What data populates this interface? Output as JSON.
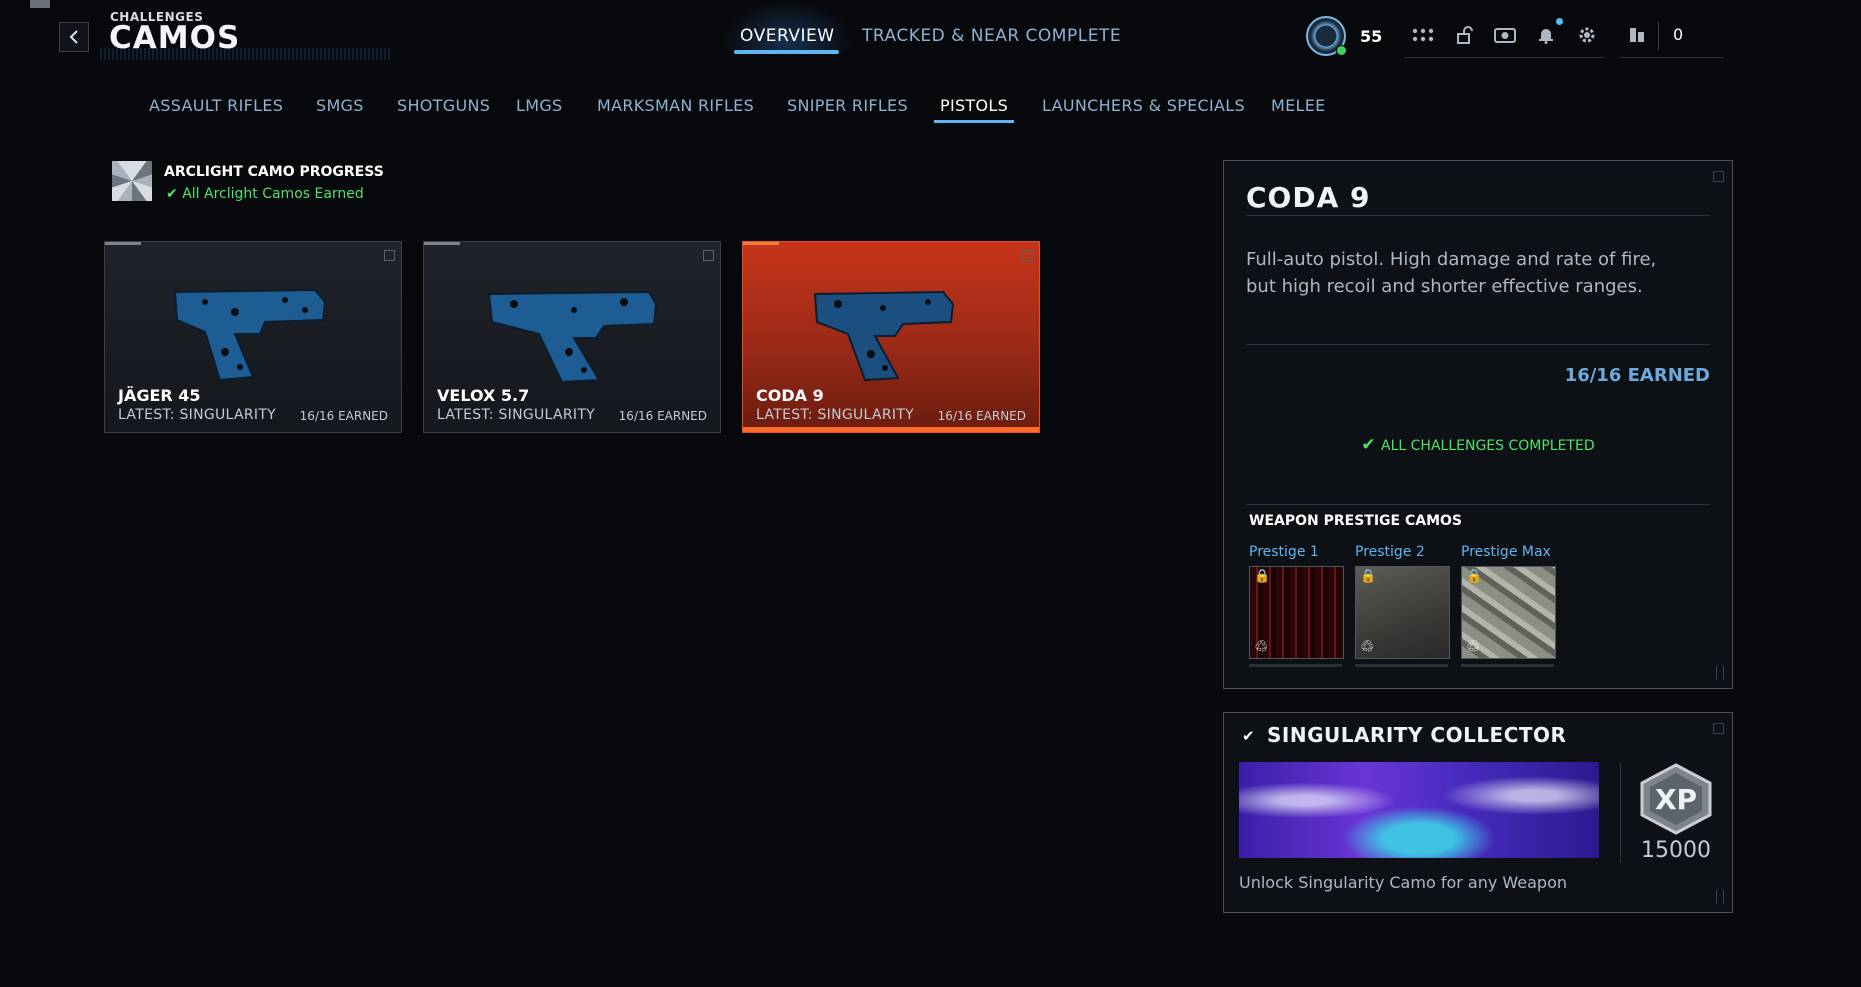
{
  "header": {
    "kicker": "CHALLENGES",
    "title": "CAMOS",
    "tabs": [
      {
        "label": "OVERVIEW",
        "active": true
      },
      {
        "label": "TRACKED & NEAR COMPLETE",
        "active": false
      }
    ],
    "level": "55",
    "currency": "0",
    "icons": [
      "avatar-icon",
      "grid-icon",
      "lock-icon",
      "camera-icon",
      "bell-icon",
      "gear-icon",
      "social-icon"
    ]
  },
  "categories": [
    {
      "label": "ASSAULT RIFLES",
      "active": false
    },
    {
      "label": "SMGS",
      "active": false
    },
    {
      "label": "SHOTGUNS",
      "active": false
    },
    {
      "label": "LMGS",
      "active": false
    },
    {
      "label": "MARKSMAN RIFLES",
      "active": false
    },
    {
      "label": "SNIPER RIFLES",
      "active": false
    },
    {
      "label": "PISTOLS",
      "active": true
    },
    {
      "label": "LAUNCHERS & SPECIALS",
      "active": false
    },
    {
      "label": "MELEE",
      "active": false
    }
  ],
  "progress": {
    "title": "ARCLIGHT CAMO PROGRESS",
    "status": "All Arclight Camos Earned"
  },
  "weapons": [
    {
      "name": "JÄGER 45",
      "latest": "LATEST: SINGULARITY",
      "earned": "16/16 EARNED",
      "selected": false
    },
    {
      "name": "VELOX 5.7",
      "latest": "LATEST: SINGULARITY",
      "earned": "16/16 EARNED",
      "selected": false
    },
    {
      "name": "CODA 9",
      "latest": "LATEST: SINGULARITY",
      "earned": "16/16 EARNED",
      "selected": true
    }
  ],
  "details": {
    "name": "CODA 9",
    "description": "Full-auto pistol. High damage and rate of fire, but high recoil and shorter effective ranges.",
    "earned": "16/16 EARNED",
    "complete": "ALL CHALLENGES COMPLETED",
    "prestige_title": "WEAPON PRESTIGE CAMOS",
    "prestige": [
      {
        "label": "Prestige 1",
        "locked": true
      },
      {
        "label": "Prestige 2",
        "locked": true
      },
      {
        "label": "Prestige Max",
        "locked": true
      }
    ]
  },
  "reward": {
    "title": "SINGULARITY COLLECTOR",
    "xp_label": "XP",
    "xp_value": "15000",
    "description": "Unlock Singularity Camo for any Weapon"
  },
  "colors": {
    "accent": "#5fb5f0",
    "success": "#4ee36a",
    "selected_card": "#c6341a",
    "earned_blue": "#6fa8dc"
  }
}
